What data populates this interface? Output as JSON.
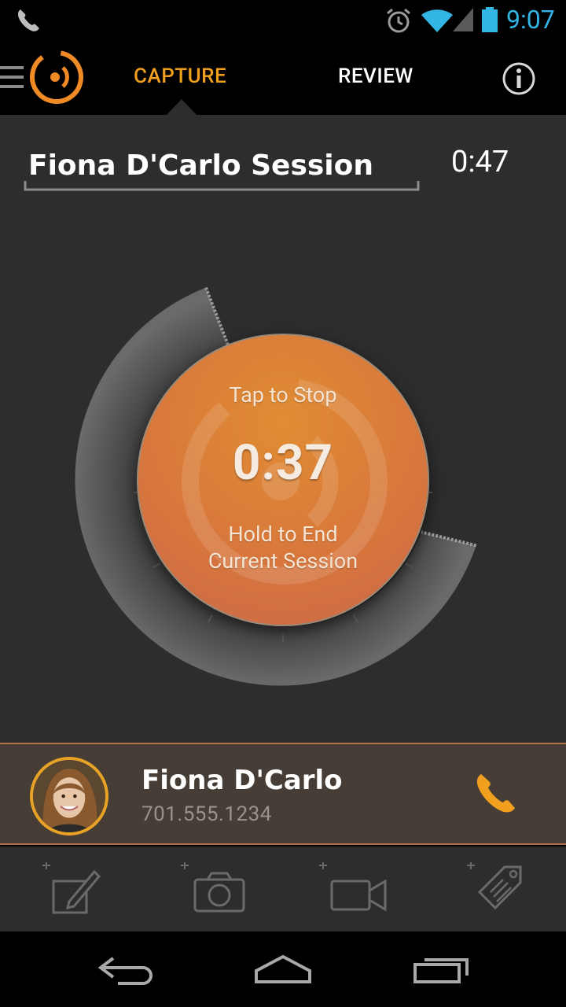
{
  "status_bar": {
    "time": "9:07",
    "icons": [
      "phone-icon",
      "alarm-icon",
      "wifi-icon",
      "signal-icon",
      "battery-icon"
    ],
    "time_color": "#33b5e5"
  },
  "action_bar": {
    "tabs": [
      {
        "label": "CAPTURE",
        "active": true
      },
      {
        "label": "REVIEW",
        "active": false
      }
    ],
    "accent": "#f0a01e"
  },
  "session": {
    "title": "Fiona D'Carlo Session",
    "total_time": "0:47"
  },
  "record": {
    "tap_label": "Tap to Stop",
    "time": "0:37",
    "hold_line1": "Hold to End",
    "hold_line2": "Current Session"
  },
  "contact": {
    "name": "Fiona D'Carlo",
    "phone": "701.555.1234"
  },
  "toolbar": {
    "items": [
      "add-note-icon",
      "add-photo-icon",
      "add-video-icon",
      "add-tag-icon"
    ]
  },
  "nav": {
    "items": [
      "back-icon",
      "home-icon",
      "recents-icon"
    ]
  }
}
